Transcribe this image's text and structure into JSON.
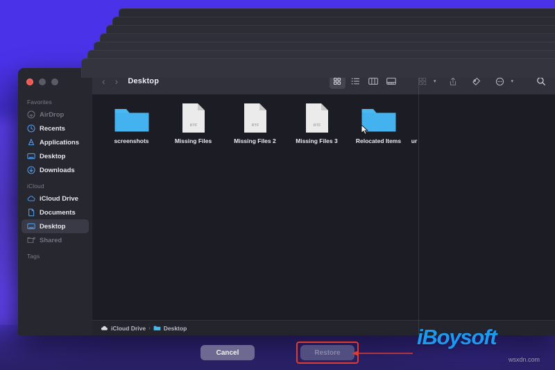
{
  "window": {
    "title": "Desktop",
    "traffic_lights": [
      "close",
      "minimize",
      "maximize"
    ]
  },
  "toolbar": {
    "back_label": "‹",
    "forward_label": "›",
    "title": "Desktop",
    "view_icon_grid": "grid-view-icon",
    "view_icon_list": "list-view-icon",
    "view_icon_column": "column-view-icon",
    "view_icon_gallery": "gallery-view-icon",
    "group_icon": "group-by-icon",
    "share_icon": "share-icon",
    "tag_icon": "tag-icon",
    "more_icon": "more-options-icon",
    "search_icon": "search-icon",
    "chevron": "▾"
  },
  "sidebar": {
    "sections": [
      {
        "title": "Favorites",
        "items": [
          {
            "label": "AirDrop",
            "icon": "airdrop-icon",
            "state": "dim"
          },
          {
            "label": "Recents",
            "icon": "recents-clock-icon",
            "state": "normal"
          },
          {
            "label": "Applications",
            "icon": "applications-icon",
            "state": "normal"
          },
          {
            "label": "Desktop",
            "icon": "desktop-monitor-icon",
            "state": "normal"
          },
          {
            "label": "Downloads",
            "icon": "downloads-arrow-icon",
            "state": "normal"
          }
        ]
      },
      {
        "title": "iCloud",
        "items": [
          {
            "label": "iCloud Drive",
            "icon": "icloud-cloud-icon",
            "state": "normal"
          },
          {
            "label": "Documents",
            "icon": "document-page-icon",
            "state": "normal"
          },
          {
            "label": "Desktop",
            "icon": "desktop-monitor-icon",
            "state": "selected"
          },
          {
            "label": "Shared",
            "icon": "shared-folder-icon",
            "state": "dim"
          }
        ]
      },
      {
        "title": "Tags",
        "items": []
      }
    ]
  },
  "files": [
    {
      "name": "screenshots",
      "type": "folder"
    },
    {
      "name": "Missing Files",
      "type": "rtf",
      "badge": "RTF"
    },
    {
      "name": "Missing Files 2",
      "type": "rtf",
      "badge": "RTF"
    },
    {
      "name": "Missing Files 3",
      "type": "rtf",
      "badge": "RTF"
    },
    {
      "name": "Relocated Items",
      "type": "folder",
      "cursor": true
    },
    {
      "name": "ur",
      "type": "clipped"
    }
  ],
  "pathbar": {
    "segments": [
      {
        "label": "iCloud Drive",
        "icon": "icloud-cloud-icon"
      },
      {
        "label": "Desktop",
        "icon": "folder-icon"
      }
    ],
    "separator": "›"
  },
  "actions": {
    "cancel_label": "Cancel",
    "restore_label": "Restore",
    "restore_disabled": true,
    "annotation_color": "#e23b30"
  },
  "watermarks": {
    "brand": "iBoysoft",
    "site": "wsxdn.com",
    "brand_color": "#1b9bf0"
  },
  "stack_layers": 7
}
